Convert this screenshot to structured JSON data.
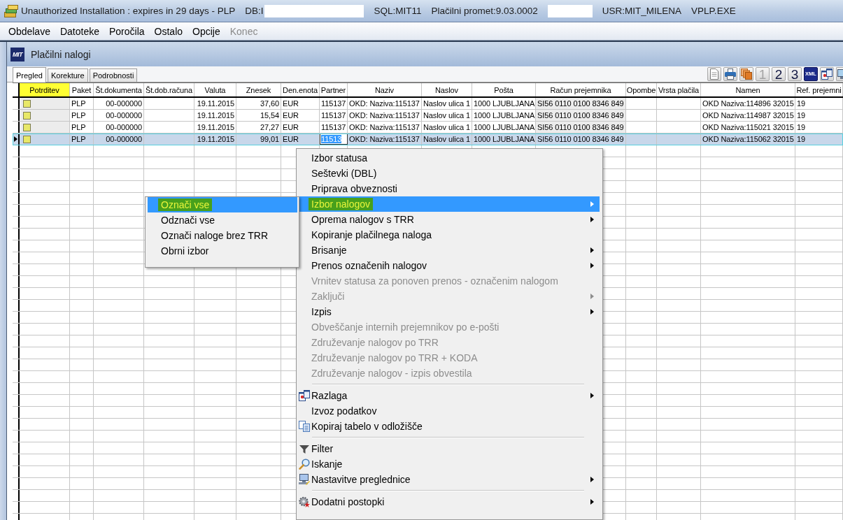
{
  "window": {
    "title_parts": [
      {
        "kind": "title",
        "text": "Unauthorized Installation : expires in 29 days - PLP"
      },
      {
        "kind": "info",
        "text": "DB:I"
      },
      {
        "kind": "redacted"
      },
      {
        "kind": "info",
        "text": "SQL:MIT11"
      },
      {
        "kind": "info",
        "text": "Plačilni promet:9.03.0002"
      },
      {
        "kind": "redacted"
      },
      {
        "kind": "info",
        "text": "USR:MIT_MILENA"
      },
      {
        "kind": "info",
        "text": "VPLP.EXE"
      }
    ]
  },
  "menu_bar": [
    {
      "label": "Obdelave",
      "disabled": false
    },
    {
      "label": "Datoteke",
      "disabled": false
    },
    {
      "label": "Poročila",
      "disabled": false
    },
    {
      "label": "Ostalo",
      "disabled": false
    },
    {
      "label": "Opcije",
      "disabled": false
    },
    {
      "label": "Konec",
      "disabled": true
    }
  ],
  "child_window": {
    "logo_text": "MIT",
    "title": "Plačilni nalogi"
  },
  "tabs": [
    {
      "label": "Pregled",
      "selected": true
    },
    {
      "label": "Korekture",
      "selected": false
    },
    {
      "label": "Podrobnosti",
      "selected": false
    }
  ],
  "toolbar": [
    {
      "kind": "document",
      "disabled": false
    },
    {
      "kind": "printer",
      "disabled": false
    },
    {
      "kind": "export",
      "disabled": false
    },
    {
      "kind": "number",
      "label": "1",
      "disabled": true
    },
    {
      "kind": "number",
      "label": "2",
      "disabled": false
    },
    {
      "kind": "number",
      "label": "3",
      "disabled": false
    },
    {
      "kind": "xml",
      "label": "XML",
      "disabled": false
    },
    {
      "kind": "help",
      "disabled": false
    },
    {
      "kind": "monitor",
      "disabled": false
    }
  ],
  "grid": {
    "columns": [
      {
        "label": "Potrditev",
        "kind": "checkbox",
        "marked": true
      },
      {
        "label": "Paket",
        "kind": "text",
        "marked": false
      },
      {
        "label": "Št.dokumenta",
        "kind": "number",
        "marked": false
      },
      {
        "label": "Št.dob.računa",
        "kind": "text",
        "marked": false
      },
      {
        "label": "Valuta",
        "kind": "number",
        "marked": false
      },
      {
        "label": "Znesek",
        "kind": "number",
        "marked": false
      },
      {
        "label": "Den.enota",
        "kind": "text",
        "marked": false
      },
      {
        "label": "Partner",
        "kind": "text",
        "marked": false
      },
      {
        "label": "Naziv",
        "kind": "text",
        "marked": false
      },
      {
        "label": "Naslov",
        "kind": "text",
        "marked": false
      },
      {
        "label": "Pošta",
        "kind": "text",
        "marked": false
      },
      {
        "label": "Račun prejemnika",
        "kind": "shaded",
        "marked": false
      },
      {
        "label": "Opombe",
        "kind": "text",
        "marked": false
      },
      {
        "label": "Vrsta plačila",
        "kind": "text",
        "marked": false
      },
      {
        "label": "Namen",
        "kind": "text",
        "marked": false
      },
      {
        "label": "Ref. prejemni",
        "kind": "text",
        "marked": false
      }
    ],
    "rows": [
      {
        "selected": false,
        "cells": [
          {
            "checked": false
          },
          "PLP",
          "00-000000",
          "",
          "19.11.2015",
          "37,60",
          "EUR",
          "115137",
          "OKD: Naziva:115137",
          "Naslov ulica 1",
          "1000 LJUBLJANA",
          "SI56 0110 0100 8346 849",
          "",
          "",
          "OKD Naziva:114896 32015",
          "19"
        ]
      },
      {
        "selected": false,
        "cells": [
          {
            "checked": false
          },
          "PLP",
          "00-000000",
          "",
          "19.11.2015",
          "15,54",
          "EUR",
          "115137",
          "OKD: Naziva:115137",
          "Naslov ulica 1",
          "1000 LJUBLJANA",
          "SI56 0110 0100 8346 849",
          "",
          "",
          "OKD Naziva:114987 32015",
          "19"
        ]
      },
      {
        "selected": false,
        "cells": [
          {
            "checked": false
          },
          "PLP",
          "00-000000",
          "",
          "19.11.2015",
          "27,27",
          "EUR",
          "115137",
          "OKD: Naziva:115137",
          "Naslov ulica 1",
          "1000 LJUBLJANA",
          "SI56 0110 0100 8346 849",
          "",
          "",
          "OKD Naziva:115021 32015",
          "19"
        ]
      },
      {
        "selected": true,
        "cells": [
          {
            "checked": false
          },
          "PLP",
          "00-000000",
          "",
          "19.11.2015",
          "99,01",
          "EUR",
          {
            "text": "11513",
            "focused": true
          },
          "OKD: Naziva:115137",
          "Naslov ulica 1",
          "1000 LJUBLJANA",
          "SI56 0110 0100 8346 849",
          "",
          "",
          "OKD Naziva:115062 32015",
          "19"
        ]
      }
    ]
  },
  "context_menu": {
    "items": [
      {
        "kind": "item",
        "label": "Izbor statusa",
        "selected": false,
        "disabled": false,
        "marked": false,
        "submenu": false
      },
      {
        "kind": "item",
        "label": "Seštevki (DBL)",
        "selected": false,
        "disabled": false,
        "marked": false,
        "submenu": false
      },
      {
        "kind": "item",
        "label": "Priprava obveznosti",
        "selected": false,
        "disabled": false,
        "marked": false,
        "submenu": false
      },
      {
        "kind": "item",
        "label": "Izbor nalogov",
        "selected": true,
        "disabled": false,
        "marked": true,
        "submenu": true
      },
      {
        "kind": "item",
        "label": "Oprema nalogov s TRR",
        "selected": false,
        "disabled": false,
        "marked": false,
        "submenu": true
      },
      {
        "kind": "item",
        "label": "Kopiranje plačilnega naloga",
        "selected": false,
        "disabled": false,
        "marked": false,
        "submenu": false
      },
      {
        "kind": "item",
        "label": "Brisanje",
        "selected": false,
        "disabled": false,
        "marked": false,
        "submenu": true
      },
      {
        "kind": "item",
        "label": "Prenos označenih nalogov",
        "selected": false,
        "disabled": false,
        "marked": false,
        "submenu": true
      },
      {
        "kind": "item",
        "label": "Vrnitev statusa za ponoven prenos - označenim nalogom",
        "selected": false,
        "disabled": true,
        "marked": false,
        "submenu": false
      },
      {
        "kind": "item",
        "label": "Zaključi",
        "selected": false,
        "disabled": true,
        "marked": false,
        "submenu": true
      },
      {
        "kind": "item",
        "label": "Izpis",
        "selected": false,
        "disabled": false,
        "marked": false,
        "submenu": true
      },
      {
        "kind": "item",
        "label": "Obveščanje internih prejemnikov po e-pošti",
        "selected": false,
        "disabled": true,
        "marked": false,
        "submenu": false
      },
      {
        "kind": "item",
        "label": "Združevanje nalogov po TRR",
        "selected": false,
        "disabled": true,
        "marked": false,
        "submenu": false
      },
      {
        "kind": "item",
        "label": "Združevanje nalogov po TRR + KODA",
        "selected": false,
        "disabled": true,
        "marked": false,
        "submenu": false
      },
      {
        "kind": "item",
        "label": "Združevanje nalogov - izpis obvestila",
        "selected": false,
        "disabled": true,
        "marked": false,
        "submenu": false
      },
      {
        "kind": "separator"
      },
      {
        "kind": "windows",
        "label": "Razlaga",
        "selected": false,
        "disabled": false,
        "marked": false,
        "submenu": true
      },
      {
        "kind": "item",
        "label": "Izvoz podatkov",
        "selected": false,
        "disabled": false,
        "marked": false,
        "submenu": false
      },
      {
        "kind": "copy",
        "label": "Kopiraj tabelo v odložišče",
        "selected": false,
        "disabled": false,
        "marked": false,
        "submenu": false
      },
      {
        "kind": "separator"
      },
      {
        "kind": "filter",
        "label": "Filter",
        "selected": false,
        "disabled": false,
        "marked": false,
        "submenu": false
      },
      {
        "kind": "search",
        "label": "Iskanje",
        "selected": false,
        "disabled": false,
        "marked": false,
        "submenu": false
      },
      {
        "kind": "computer",
        "label": "Nastavitve preglednice",
        "selected": false,
        "disabled": false,
        "marked": false,
        "submenu": true
      },
      {
        "kind": "separator"
      },
      {
        "kind": "gear",
        "label": "Dodatni postopki",
        "selected": false,
        "disabled": false,
        "marked": false,
        "submenu": true
      }
    ]
  },
  "submenu": {
    "items": [
      {
        "label": "Označi vse",
        "selected": true,
        "marked": true
      },
      {
        "label": "Odznači vse",
        "selected": false,
        "marked": false
      },
      {
        "label": "Označi naloge brez TRR",
        "selected": false,
        "marked": false
      },
      {
        "label": "Obrni izbor",
        "selected": false,
        "marked": false
      }
    ]
  }
}
